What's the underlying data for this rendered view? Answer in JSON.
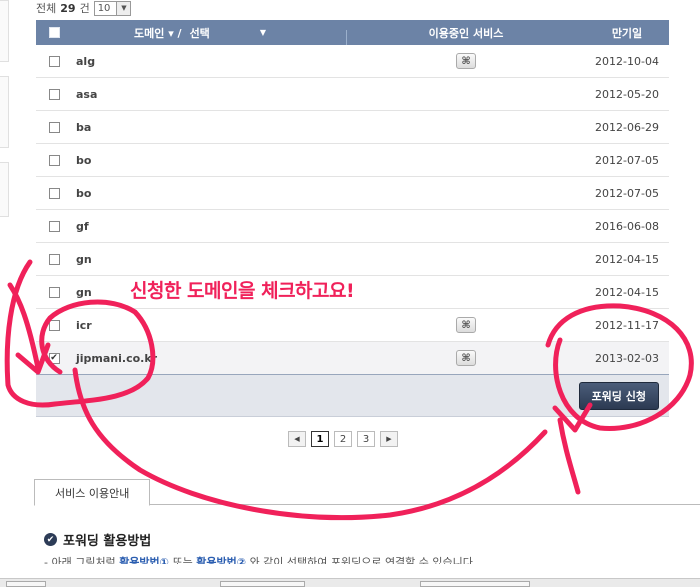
{
  "top": {
    "total_label": "전체",
    "total_count": "29",
    "unit": "건",
    "page_size": "10"
  },
  "table": {
    "headers": {
      "domain": "도메인 ▾ /",
      "select_label": "선택",
      "service": "이용중인 서비스",
      "expire": "만기일"
    },
    "rows": [
      {
        "domain": "alg",
        "expire": "2012-10-04",
        "service_icon": true,
        "checked": false
      },
      {
        "domain": "asa",
        "expire": "2012-05-20",
        "service_icon": false,
        "checked": false
      },
      {
        "domain": "ba",
        "expire": "2012-06-29",
        "service_icon": false,
        "checked": false
      },
      {
        "domain": "bo",
        "expire": "2012-07-05",
        "service_icon": false,
        "checked": false
      },
      {
        "domain": "bo",
        "expire": "2012-07-05",
        "service_icon": false,
        "checked": false
      },
      {
        "domain": "gf",
        "expire": "2016-06-08",
        "service_icon": false,
        "checked": false
      },
      {
        "domain": "gn",
        "expire": "2012-04-15",
        "service_icon": false,
        "checked": false
      },
      {
        "domain": "gn",
        "expire": "2012-04-15",
        "service_icon": false,
        "checked": false
      },
      {
        "domain": "icr",
        "expire": "2012-11-17",
        "service_icon": true,
        "checked": false
      },
      {
        "domain": "jipmani.co.kr",
        "expire": "2013-02-03",
        "service_icon": true,
        "checked": true
      }
    ],
    "forward_button": "포워딩 신청"
  },
  "pagination": {
    "pages": [
      "1",
      "2",
      "3"
    ],
    "current": "1",
    "prev": "◀",
    "next": "▶"
  },
  "tabs": {
    "service_guide": "서비스 이용안내"
  },
  "guide": {
    "title": "포워딩 활용방법",
    "text_prefix": "- 아래 그림처럼 ",
    "link1": "활용방법①",
    "text_mid": " 또는 ",
    "link2": "활용방법②",
    "text_suffix": " 와 같이 선택하여 포워딩으로 연결할 수 있습니다."
  },
  "annotation": {
    "text": "신청한 도메인을 체크하고요!",
    "color": "#f0215a"
  },
  "icons": {
    "service": "forwarding-service-icon",
    "guide": "check-circle-icon"
  },
  "colors": {
    "header": "#6c83a6",
    "button": "#2c3a52",
    "scribble": "#f0215a"
  }
}
